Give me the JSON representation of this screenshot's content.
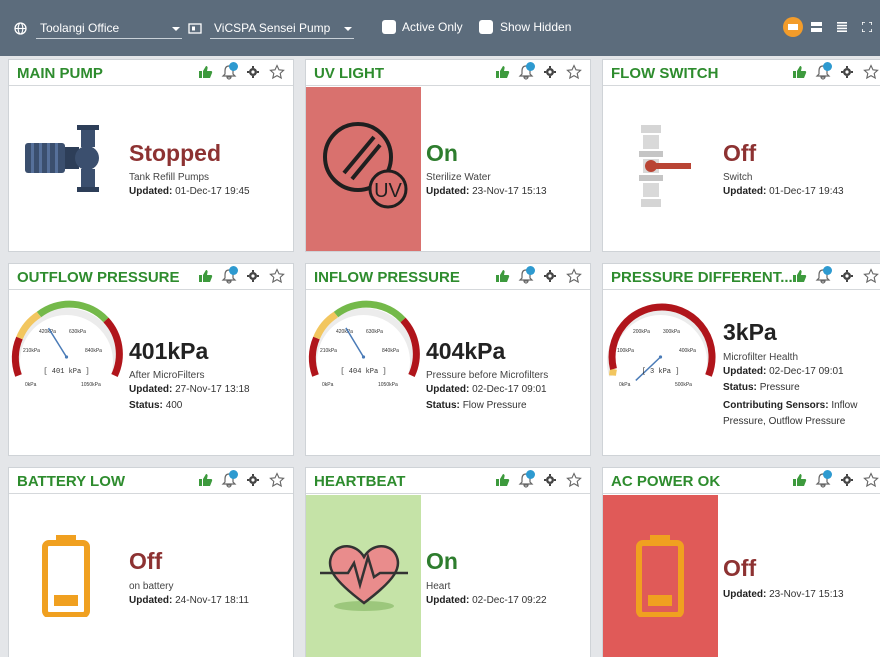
{
  "topbar": {
    "site": "Toolangi Office",
    "device": "ViCSPA Sensei Pump",
    "active_only": "Active Only",
    "show_hidden": "Show Hidden",
    "icons": [
      "globe-icon",
      "device-icon",
      "tile-view-icon",
      "list-view-icon",
      "compact-list-icon",
      "fullscreen-icon"
    ]
  },
  "colors": {
    "title_green": "#2e8c2e",
    "off_red": "#8d3232",
    "on_green": "#2e7d2e",
    "panel_red": "#d9716e",
    "panel_bright_red": "#e05a58",
    "panel_green": "#c5e3a7",
    "badge_blue": "#2e9ad0",
    "battery_orange": "#f0a020"
  },
  "common": {
    "updated_label": "Updated:",
    "status_label": "Status:",
    "contributing_label": "Contributing Sensors:"
  },
  "cards": {
    "main_pump": {
      "title": "MAIN PUMP",
      "state": "Stopped",
      "desc": "Tank Refill Pumps",
      "updated": "01-Dec-17 19:45"
    },
    "uv_light": {
      "title": "UV LIGHT",
      "state": "On",
      "desc": "Sterilize Water",
      "updated": "23-Nov-17 15:13",
      "panel_text": "UV"
    },
    "flow_switch": {
      "title": "FLOW SWITCH",
      "state": "Off",
      "desc": "Switch",
      "updated": "01-Dec-17 19:43"
    },
    "outflow_pressure": {
      "title": "OUTFLOW PRESSURE",
      "state": "401kPa",
      "desc": "After MicroFilters",
      "updated": "27-Nov-17 13:18",
      "status": "400",
      "gauge": {
        "value": 401,
        "readout": "[ 401 kPa ]",
        "ticks": [
          "0kPa",
          "210kPa",
          "420kPa",
          "630kPa",
          "840kPa",
          "1050kPa"
        ]
      }
    },
    "inflow_pressure": {
      "title": "INFLOW PRESSURE",
      "state": "404kPa",
      "desc": "Pressure before Microfilters",
      "updated": "02-Dec-17 09:01",
      "status": "Flow Pressure",
      "gauge": {
        "value": 404,
        "readout": "[ 404 kPa ]",
        "ticks": [
          "0kPa",
          "210kPa",
          "420kPa",
          "630kPa",
          "840kPa",
          "1050kPa"
        ]
      }
    },
    "pressure_diff": {
      "title": "PRESSURE DIFFERENT...",
      "state": "3kPa",
      "desc": "Microfilter Health",
      "updated": "02-Dec-17 09:01",
      "status": "Pressure",
      "contributing": "Inflow Pressure, Outflow Pressure",
      "gauge": {
        "value": 3,
        "readout": "[ 3 kPa ]",
        "ticks": [
          "0kPa",
          "100kPa",
          "200kPa",
          "300kPa",
          "400kPa",
          "500kPa"
        ]
      }
    },
    "battery_low": {
      "title": "BATTERY LOW",
      "state": "Off",
      "desc": "on battery",
      "updated": "24-Nov-17 18:11"
    },
    "heartbeat": {
      "title": "HEARTBEAT",
      "state": "On",
      "desc": "Heart",
      "updated": "02-Dec-17 09:22"
    },
    "ac_power": {
      "title": "AC POWER OK",
      "state": "Off",
      "updated": "23-Nov-17 15:13"
    }
  }
}
